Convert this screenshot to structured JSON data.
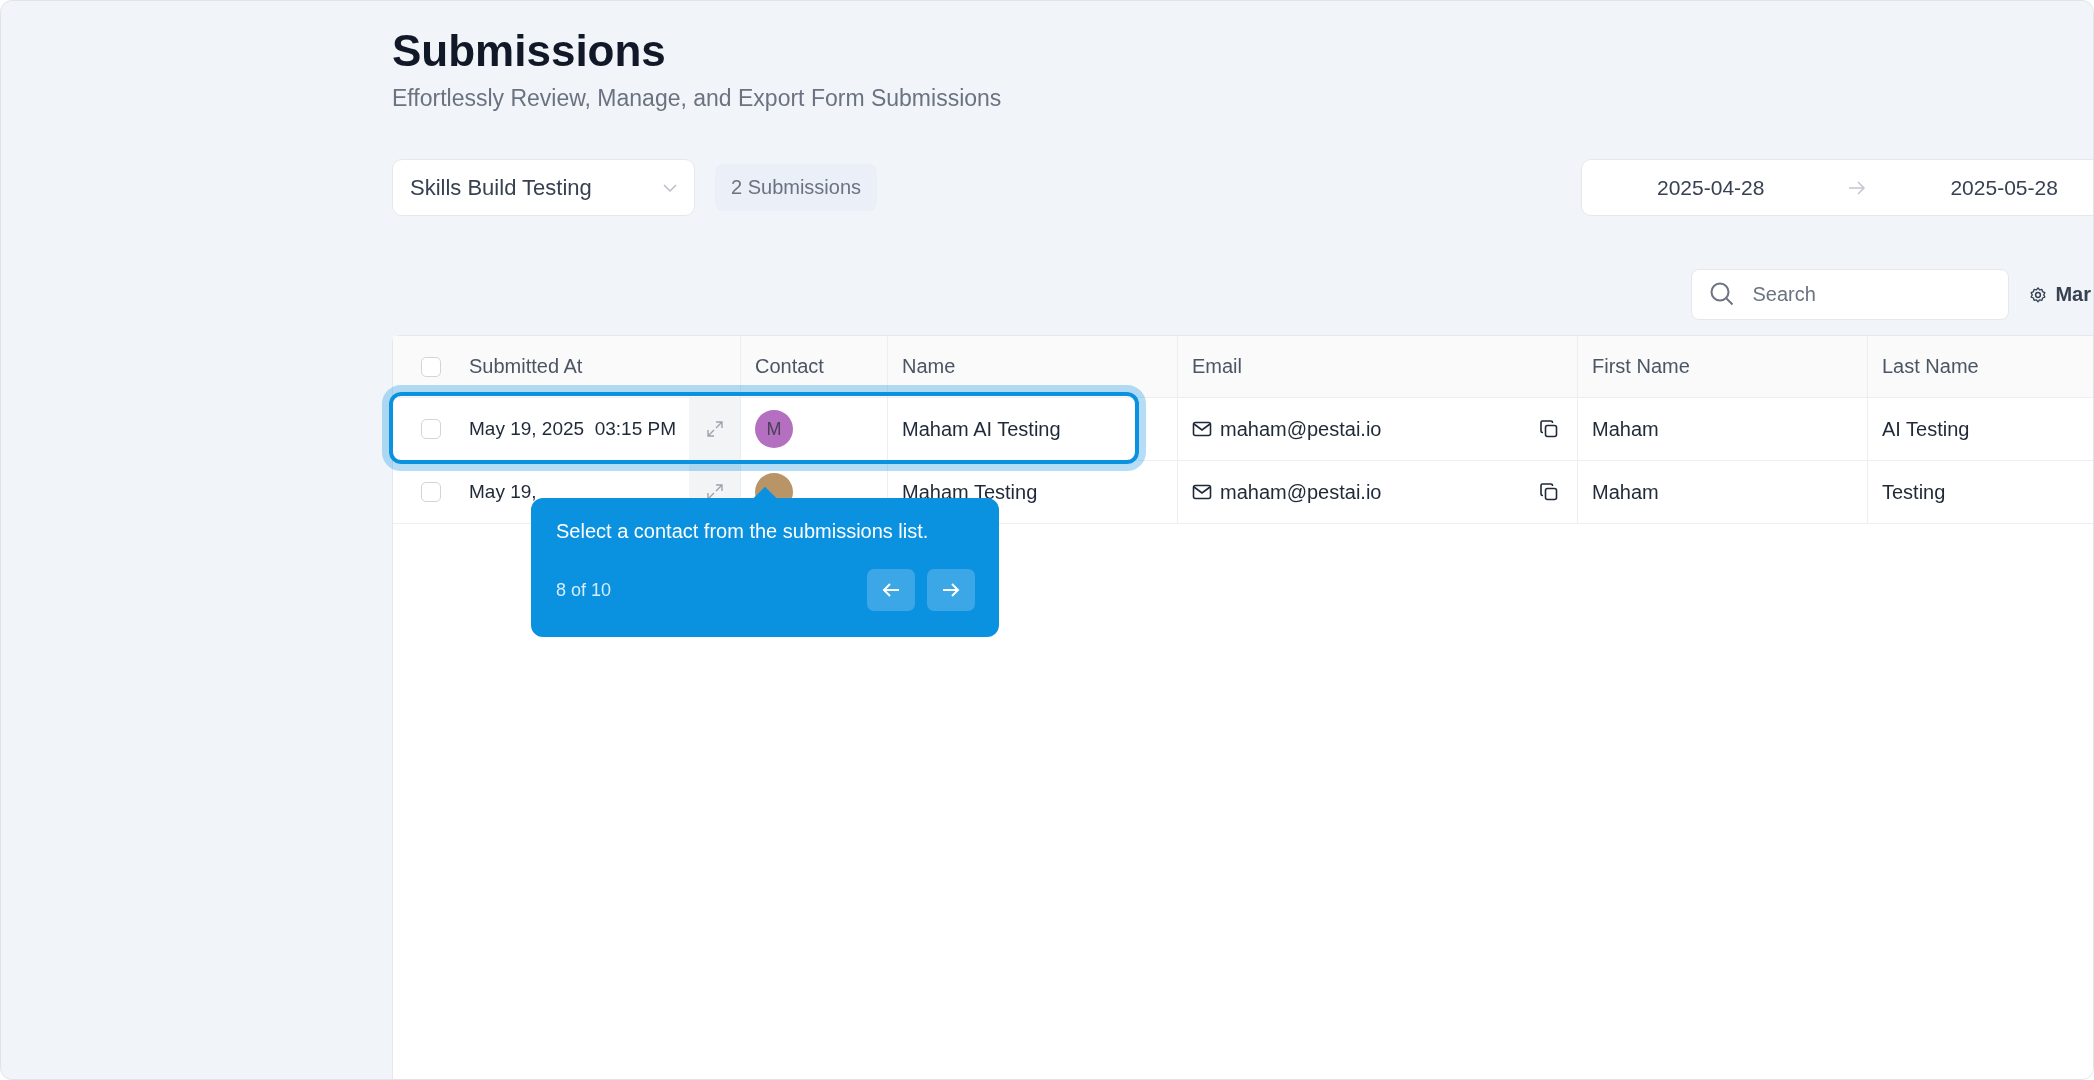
{
  "page": {
    "title": "Submissions",
    "subtitle": "Effortlessly Review, Manage, and Export Form Submissions"
  },
  "form_select": {
    "value": "Skills Build Testing"
  },
  "count_badge": "2 Submissions",
  "date_range": {
    "start": "2025-04-28",
    "end": "2025-05-28"
  },
  "search": {
    "placeholder": "Search"
  },
  "manage_button": {
    "label": "Mar"
  },
  "table": {
    "select_all": {
      "checked": false
    },
    "columns": [
      "Submitted At",
      "Contact",
      "Name",
      "Email",
      "First Name",
      "Last Name"
    ],
    "rows": [
      {
        "highlighted": true,
        "checked": false,
        "submitted_at": "May 19, 2025  03:15 PM",
        "contact": {
          "initial": "M",
          "color": "#b46fc0"
        },
        "name": "Maham AI Testing",
        "email": "maham@pestai.io",
        "first_name": "Maham",
        "last_name": "AI Testing"
      },
      {
        "highlighted": false,
        "checked": false,
        "submitted_at": "May 19,",
        "contact": {
          "color": "#b89466"
        },
        "name": "Maham Testing",
        "email": "maham@pestai.io",
        "first_name": "Maham",
        "last_name": "Testing"
      }
    ]
  },
  "tour": {
    "text": "Select a contact from the submissions list.",
    "step": "8 of 10"
  }
}
